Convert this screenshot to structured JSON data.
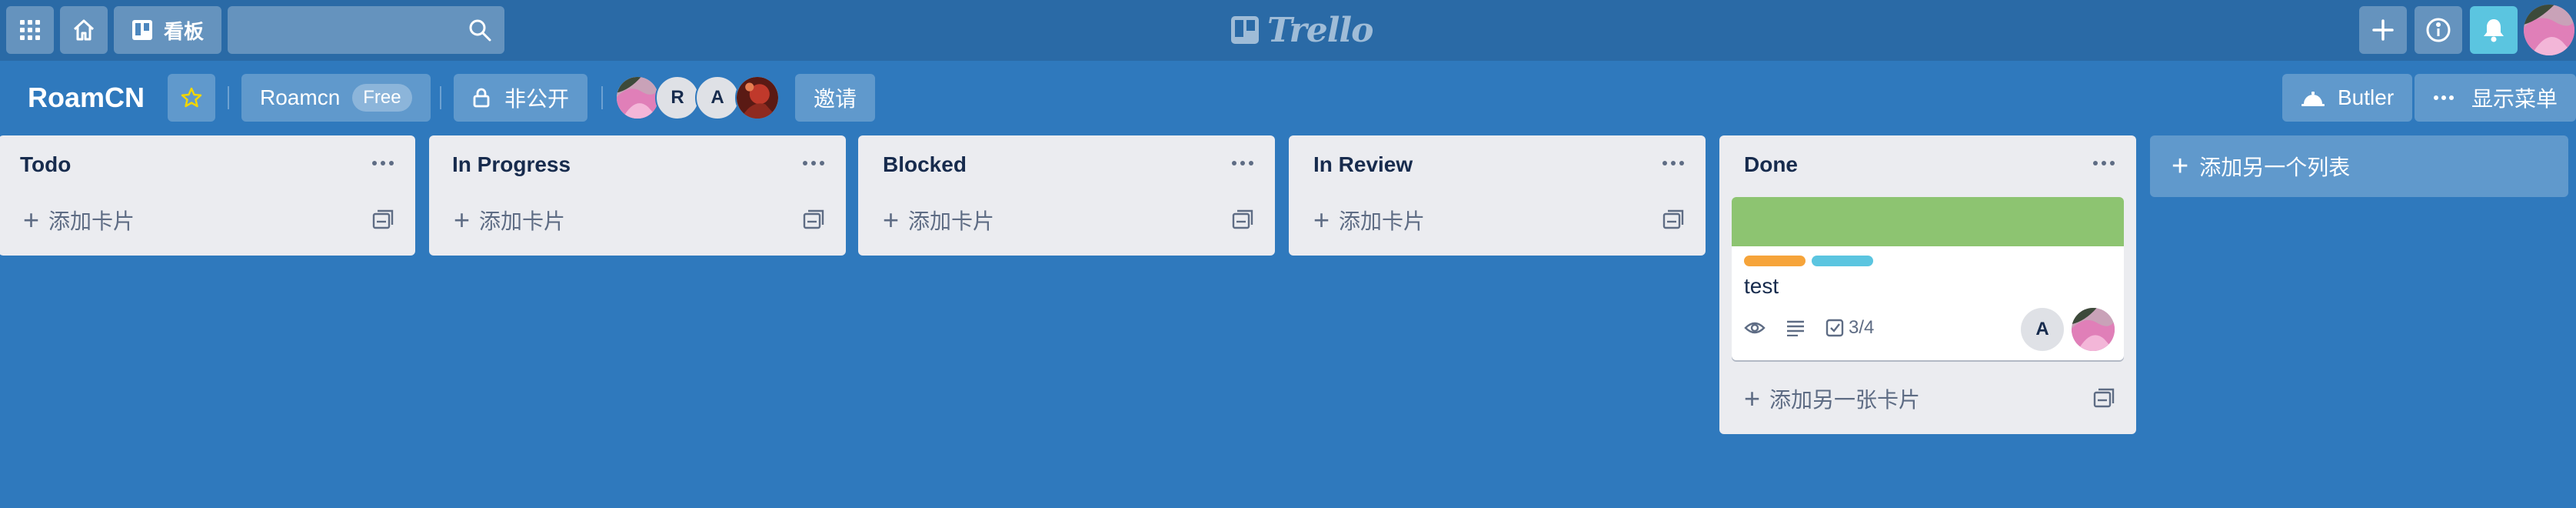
{
  "header": {
    "apps_icon": "grid-icon",
    "home_icon": "home-icon",
    "boards_label": "看板",
    "search": {
      "value": "",
      "placeholder": ""
    },
    "logo_text": "Trello",
    "create_icon": "plus-icon",
    "info_icon": "info-icon",
    "notifications_icon": "bell-icon"
  },
  "board": {
    "title": "RoamCN",
    "star_icon": "star-icon",
    "team_name": "Roamcn",
    "team_badge": "Free",
    "visibility_label": "非公开",
    "members": [
      {
        "initial": "",
        "type": "photo-pink"
      },
      {
        "initial": "R",
        "type": "initials"
      },
      {
        "initial": "A",
        "type": "initials"
      },
      {
        "initial": "",
        "type": "photo-red"
      }
    ],
    "invite_label": "邀请",
    "butler_label": "Butler",
    "show_menu_label": "显示菜单"
  },
  "lists": [
    {
      "title": "Todo",
      "add_card_label": "添加卡片"
    },
    {
      "title": "In Progress",
      "add_card_label": "添加卡片"
    },
    {
      "title": "Blocked",
      "add_card_label": "添加卡片"
    },
    {
      "title": "In Review",
      "add_card_label": "添加卡片"
    },
    {
      "title": "Done",
      "add_card_label": "添加另一张卡片",
      "cards": [
        {
          "title": "test",
          "cover_color": "#8dc471",
          "labels": [
            "#f6a43a",
            "#5bc5e0"
          ],
          "badges": {
            "watch_icon": "eye-icon",
            "description_icon": "description-icon",
            "checklist": "3/4"
          },
          "members": [
            "A"
          ]
        }
      ]
    }
  ],
  "add_list_label": "添加另一个列表",
  "colors": {
    "board_bg": "#2f79bd",
    "header_bg": "#2a6aa6",
    "list_bg": "#ebecf0"
  }
}
